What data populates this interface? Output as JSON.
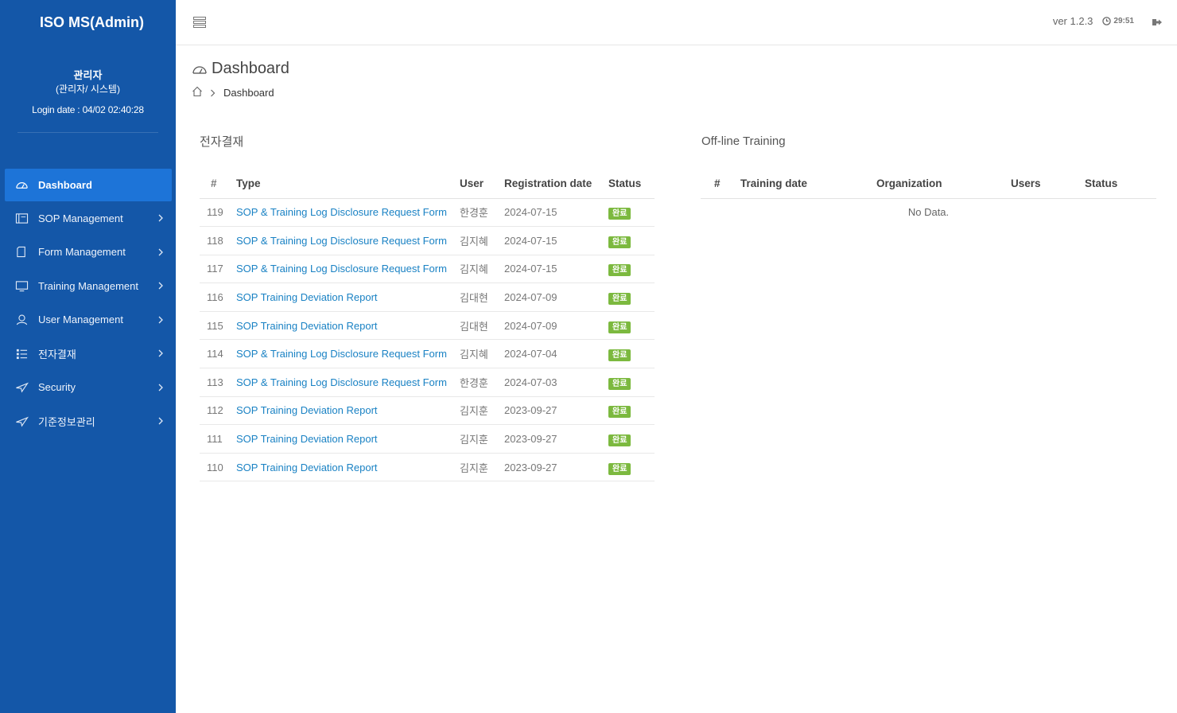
{
  "app": {
    "title": "ISO MS(Admin)"
  },
  "profile": {
    "name": "관리자",
    "role": "(관리자/ 시스템)",
    "login": "Login date : 04/02 02:40:28"
  },
  "menu": [
    {
      "label": "Dashboard",
      "icon": "dashboard-gauge-icon",
      "active": true
    },
    {
      "label": "SOP Management",
      "icon": "sop-book-icon"
    },
    {
      "label": "Form Management",
      "icon": "form-page-icon"
    },
    {
      "label": "Training Management",
      "icon": "monitor-icon"
    },
    {
      "label": "User Management",
      "icon": "user-icon"
    },
    {
      "label": "전자결재",
      "icon": "approval-list-icon"
    },
    {
      "label": "Security",
      "icon": "security-plane-icon"
    },
    {
      "label": "기준정보관리",
      "icon": "reference-plane-icon"
    }
  ],
  "topbar": {
    "version": "ver 1.2.3",
    "timer": "29:51"
  },
  "page": {
    "title": "Dashboard",
    "breadcrumb_current": "Dashboard"
  },
  "approvals": {
    "title": "전자결재",
    "headers": {
      "num": "#",
      "type": "Type",
      "user": "User",
      "date": "Registration date",
      "status": "Status"
    },
    "rows": [
      {
        "num": "119",
        "type": "SOP & Training Log Disclosure Request Form",
        "user": "한경훈",
        "date": "2024-07-15",
        "status": "완료"
      },
      {
        "num": "118",
        "type": "SOP & Training Log Disclosure Request Form",
        "user": "김지혜",
        "date": "2024-07-15",
        "status": "완료"
      },
      {
        "num": "117",
        "type": "SOP & Training Log Disclosure Request Form",
        "user": "김지혜",
        "date": "2024-07-15",
        "status": "완료"
      },
      {
        "num": "116",
        "type": "SOP Training Deviation Report",
        "user": "김대현",
        "date": "2024-07-09",
        "status": "완료"
      },
      {
        "num": "115",
        "type": "SOP Training Deviation Report",
        "user": "김대현",
        "date": "2024-07-09",
        "status": "완료"
      },
      {
        "num": "114",
        "type": "SOP & Training Log Disclosure Request Form",
        "user": "김지혜",
        "date": "2024-07-04",
        "status": "완료"
      },
      {
        "num": "113",
        "type": "SOP & Training Log Disclosure Request Form",
        "user": "한경훈",
        "date": "2024-07-03",
        "status": "완료"
      },
      {
        "num": "112",
        "type": "SOP Training Deviation Report",
        "user": "김지훈",
        "date": "2023-09-27",
        "status": "완료"
      },
      {
        "num": "111",
        "type": "SOP Training Deviation Report",
        "user": "김지훈",
        "date": "2023-09-27",
        "status": "완료"
      },
      {
        "num": "110",
        "type": "SOP Training Deviation Report",
        "user": "김지훈",
        "date": "2023-09-27",
        "status": "완료"
      }
    ]
  },
  "training": {
    "title": "Off-line Training",
    "headers": {
      "num": "#",
      "date": "Training date",
      "org": "Organization",
      "users": "Users",
      "status": "Status"
    },
    "empty": "No Data."
  },
  "colors": {
    "sidebar": "#1457a8",
    "active": "#1d74d8",
    "link": "#1a82c4",
    "badge": "#7cb93f"
  }
}
